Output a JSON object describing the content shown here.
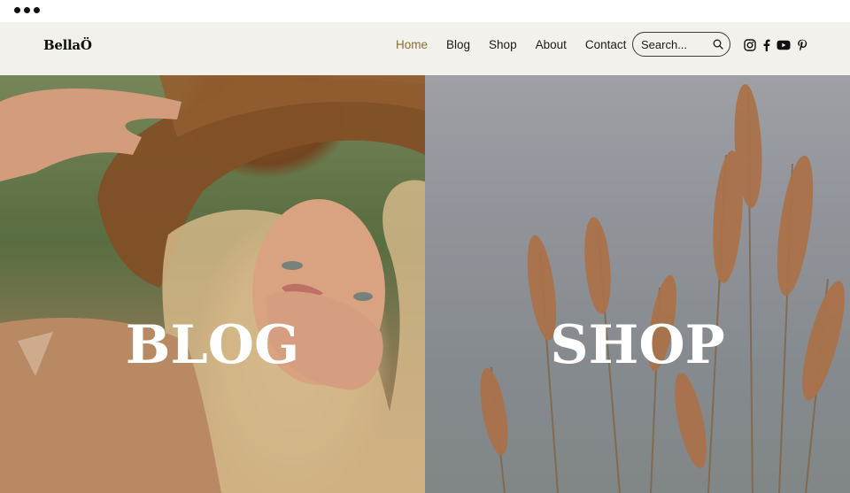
{
  "window": {
    "menu_icon": "ellipsis-icon"
  },
  "header": {
    "logo": "BellaÖ",
    "nav": [
      {
        "label": "Home",
        "active": true
      },
      {
        "label": "Blog",
        "active": false
      },
      {
        "label": "Shop",
        "active": false
      },
      {
        "label": "About",
        "active": false
      },
      {
        "label": "Contact",
        "active": false
      }
    ],
    "search": {
      "placeholder": "Search...",
      "icon": "search-icon"
    },
    "socials": [
      "instagram-icon",
      "facebook-icon",
      "youtube-icon",
      "pinterest-icon"
    ]
  },
  "hero": {
    "panels": [
      {
        "title": "BLOG",
        "image": "woman in straw hat photo"
      },
      {
        "title": "SHOP",
        "image": "pampas grass photo"
      }
    ]
  },
  "colors": {
    "header_bg": "#f3f1ec",
    "nav_active": "#8a6e2f",
    "text": "#1a1a1a"
  }
}
